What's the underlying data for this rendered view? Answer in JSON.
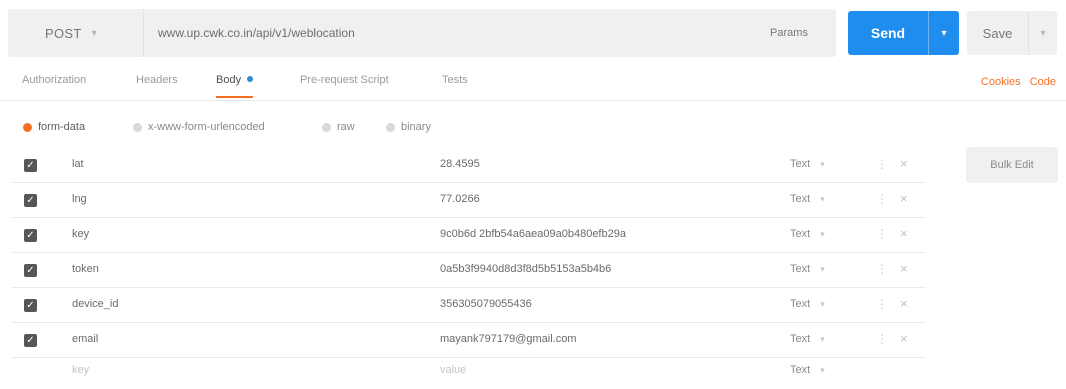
{
  "request": {
    "method": "POST",
    "url": "www.up.cwk.co.in/api/v1/weblocation",
    "params_label": "Params",
    "send_label": "Send",
    "save_label": "Save"
  },
  "tabs": [
    {
      "label": "Authorization",
      "active": false
    },
    {
      "label": "Headers",
      "active": false
    },
    {
      "label": "Body",
      "active": true
    },
    {
      "label": "Pre-request Script",
      "active": false
    },
    {
      "label": "Tests",
      "active": false
    }
  ],
  "right_links": {
    "cookies": "Cookies",
    "code": "Code"
  },
  "body_types": [
    {
      "label": "form-data",
      "selected": true
    },
    {
      "label": "x-www-form-urlencoded",
      "selected": false
    },
    {
      "label": "raw",
      "selected": false
    },
    {
      "label": "binary",
      "selected": false
    }
  ],
  "rows": [
    {
      "key": "lat",
      "value": "28.4595",
      "type": "Text",
      "checked": true
    },
    {
      "key": "lng",
      "value": "77.0266",
      "type": "Text",
      "checked": true
    },
    {
      "key": "key",
      "value": "9c0b6d 2bfb54a6aea09a0b480efb29a",
      "type": "Text",
      "checked": true
    },
    {
      "key": "token",
      "value": "0a5b3f9940d8d3f8d5b5153a5b4b6",
      "type": "Text",
      "checked": true
    },
    {
      "key": "device_id",
      "value": "356305079055436",
      "type": "Text",
      "checked": true
    },
    {
      "key": "email",
      "value": "mayank797179@gmail.com",
      "type": "Text",
      "checked": true
    }
  ],
  "placeholder_row": {
    "key": "key",
    "value": "value",
    "type": "Text"
  },
  "bulk_edit_label": "Bulk Edit",
  "colors": {
    "accent": "#f47023",
    "send": "#1f8ded",
    "active_dot": "#2d8bd4"
  }
}
